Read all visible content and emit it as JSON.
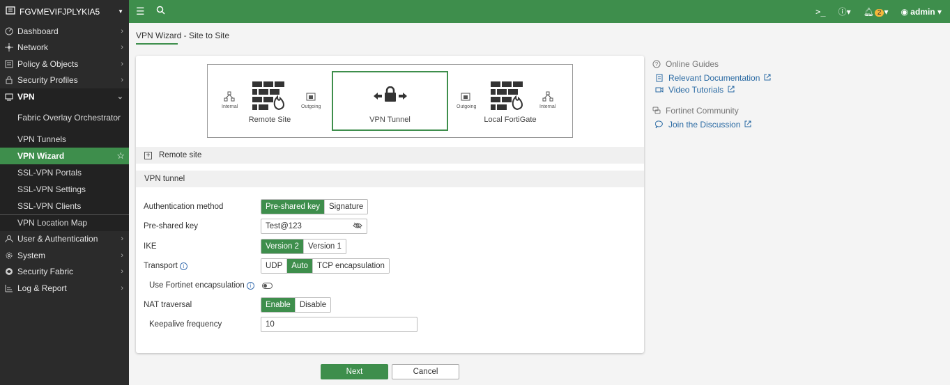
{
  "device": {
    "name": "FGVMEVIFJPLYKIA5"
  },
  "sidebar": {
    "items": [
      {
        "label": "Dashboard",
        "icon": "dashboard-icon"
      },
      {
        "label": "Network",
        "icon": "network-icon"
      },
      {
        "label": "Policy & Objects",
        "icon": "policy-icon"
      },
      {
        "label": "Security Profiles",
        "icon": "lock-icon"
      },
      {
        "label": "VPN",
        "icon": "monitor-icon"
      },
      {
        "label": "User & Authentication",
        "icon": "user-icon"
      },
      {
        "label": "System",
        "icon": "gear-icon"
      },
      {
        "label": "Security Fabric",
        "icon": "fabric-icon"
      },
      {
        "label": "Log & Report",
        "icon": "log-icon"
      }
    ],
    "vpn_sub": [
      "Fabric Overlay Orchestrator",
      "VPN Tunnels",
      "VPN Wizard",
      "SSL-VPN Portals",
      "SSL-VPN Settings",
      "SSL-VPN Clients",
      "VPN Location Map"
    ]
  },
  "topbar": {
    "notifications": "2",
    "user": "admin"
  },
  "page": {
    "title": "VPN Wizard - Site to Site"
  },
  "diagram": {
    "left_title": "Remote Site",
    "mid_title": "VPN Tunnel",
    "right_title": "Local FortiGate",
    "internal": "Internal",
    "outgoing": "Outgoing"
  },
  "sections": {
    "remote_site": "Remote site",
    "vpn_tunnel": "VPN tunnel"
  },
  "form": {
    "auth_label": "Authentication method",
    "auth_opts": [
      "Pre-shared key",
      "Signature"
    ],
    "psk_label": "Pre-shared key",
    "psk_value": "Test@123",
    "ike_label": "IKE",
    "ike_opts": [
      "Version 2",
      "Version 1"
    ],
    "transport_label": "Transport",
    "transport_opts": [
      "UDP",
      "Auto",
      "TCP encapsulation"
    ],
    "fortinet_encap_label": "Use Fortinet encapsulation",
    "nat_label": "NAT traversal",
    "nat_opts": [
      "Enable",
      "Disable"
    ],
    "keepalive_label": "Keepalive frequency",
    "keepalive_value": "10"
  },
  "buttons": {
    "next": "Next",
    "cancel": "Cancel"
  },
  "right_panel": {
    "online_guides": "Online Guides",
    "relevant_docs": "Relevant Documentation",
    "video_tutorials": "Video Tutorials",
    "community": "Fortinet Community",
    "join": "Join the Discussion"
  },
  "colors": {
    "accent": "#3e8e4c",
    "sidebar_bg": "#2b2b2b",
    "link": "#2a6aa3",
    "badge": "#f5b73b"
  }
}
